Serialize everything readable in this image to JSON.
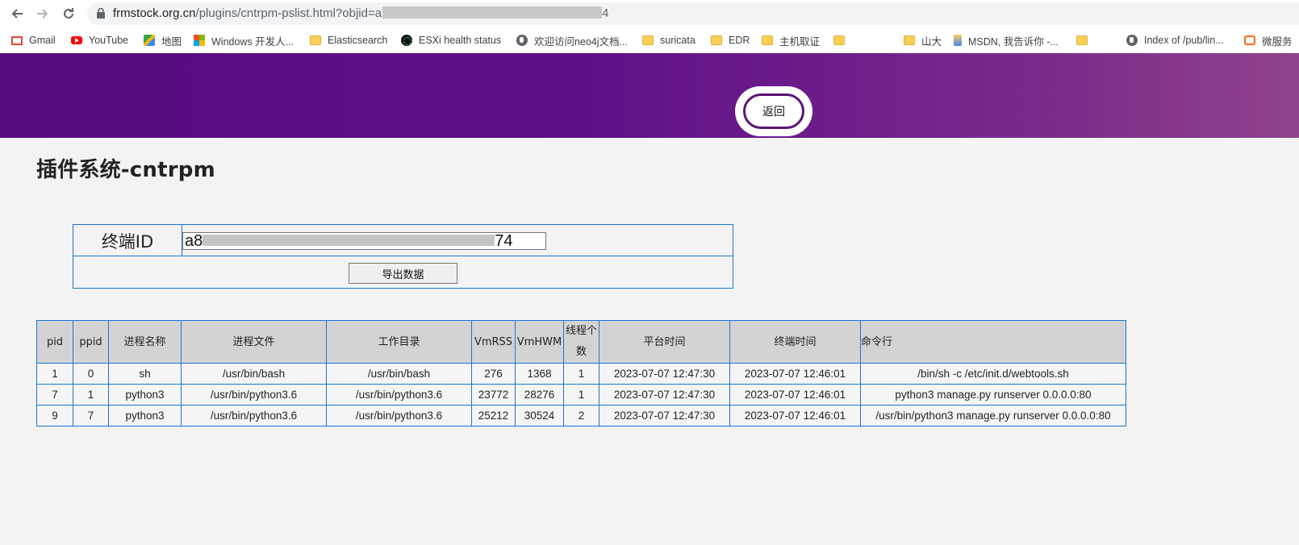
{
  "browser": {
    "url_host": "frmstock.org.cn",
    "url_path": "/plugins/cntrpm-pslist.html?objid=a",
    "url_tail": "4",
    "bookmarks": [
      {
        "label": "Gmail",
        "icon": "gmail-icon"
      },
      {
        "label": "YouTube",
        "icon": "youtube-icon"
      },
      {
        "label": "地图",
        "icon": "maps-icon"
      },
      {
        "label": "Windows 开发人...",
        "icon": "windows-icon"
      },
      {
        "label": "Elasticsearch",
        "icon": "folder-icon"
      },
      {
        "label": "ESXi health status",
        "icon": "esxi-icon"
      },
      {
        "label": "欢迎访问neo4j文档...",
        "icon": "globe-icon"
      },
      {
        "label": "suricata",
        "icon": "folder-icon"
      },
      {
        "label": "EDR",
        "icon": "folder-icon"
      },
      {
        "label": "主机取证",
        "icon": "folder-icon"
      },
      {
        "label": "",
        "icon": "folder-icon"
      },
      {
        "label": "山大",
        "icon": "folder-icon"
      },
      {
        "label": "MSDN, 我告诉你 -...",
        "icon": "msdn-icon"
      },
      {
        "label": "",
        "icon": "folder-icon"
      },
      {
        "label": "Index of /pub/lin...",
        "icon": "globe-icon"
      },
      {
        "label": "微服务",
        "icon": "aliyun-icon"
      }
    ]
  },
  "header": {
    "back_label": "返回"
  },
  "page": {
    "title": "插件系统-cntrpm"
  },
  "form": {
    "label": "终端ID",
    "id_prefix": "a8",
    "id_suffix": "74",
    "export_label": "导出数据"
  },
  "table": {
    "columns": [
      "pid",
      "ppid",
      "进程名称",
      "进程文件",
      "工作目录",
      "VmRSS",
      "VmHWM",
      "线程个数",
      "平台时间",
      "终端时间",
      "命令行"
    ],
    "rows": [
      [
        "1",
        "0",
        "sh",
        "/usr/bin/bash",
        "/usr/bin/bash",
        "276",
        "1368",
        "1",
        "2023-07-07 12:47:30",
        "2023-07-07 12:46:01",
        "/bin/sh -c /etc/init.d/webtools.sh"
      ],
      [
        "7",
        "1",
        "python3",
        "/usr/bin/python3.6",
        "/usr/bin/python3.6",
        "23772",
        "28276",
        "1",
        "2023-07-07 12:47:30",
        "2023-07-07 12:46:01",
        "python3 manage.py runserver 0.0.0.0:80"
      ],
      [
        "9",
        "7",
        "python3",
        "/usr/bin/python3.6",
        "/usr/bin/python3.6",
        "25212",
        "30524",
        "2",
        "2023-07-07 12:47:30",
        "2023-07-07 12:46:01",
        "/usr/bin/python3 manage.py runserver 0.0.0.0:80"
      ]
    ]
  },
  "colors": {
    "banner_start": "#560b80",
    "banner_end": "#90438d",
    "table_border": "#1a74d6",
    "header_bg": "#d3d3d3"
  }
}
